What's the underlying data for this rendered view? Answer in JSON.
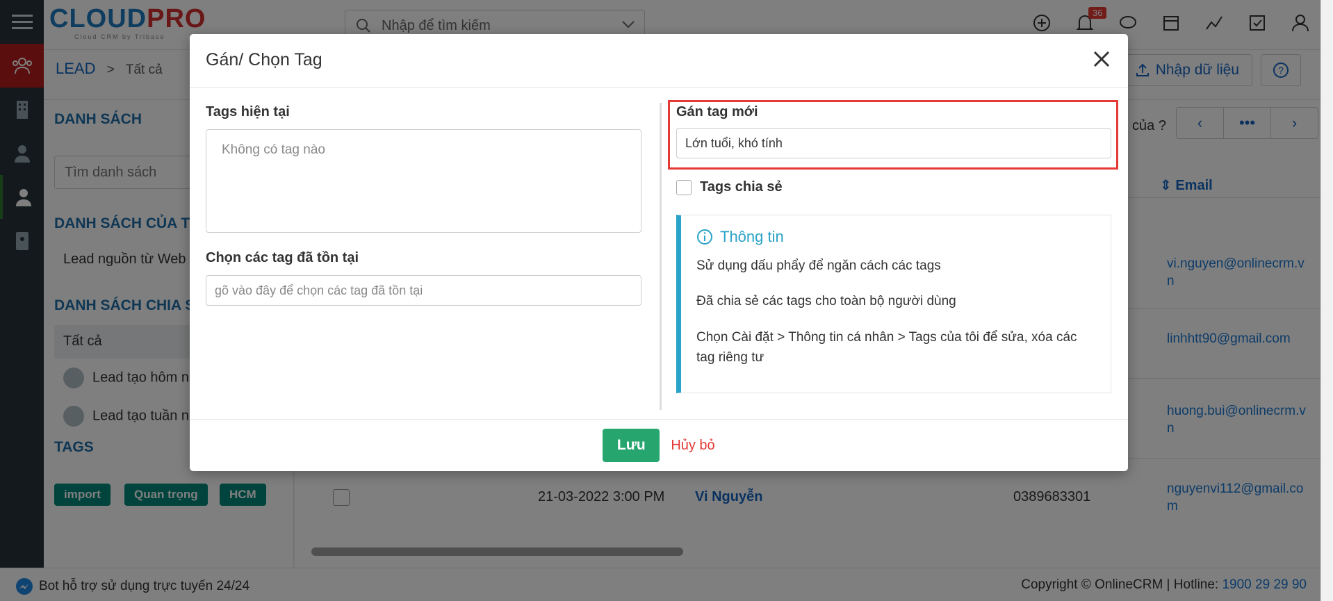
{
  "app": {
    "logo_text_cloud": "CLOUD",
    "logo_text_pro": "PRO",
    "logo_subtitle": "Cloud CRM by Tribase",
    "search_placeholder": "Nhập để tìm kiếm",
    "notification_count": "36"
  },
  "breadcrumb": {
    "module": "LEAD",
    "separator": ">",
    "current": "Tất cả"
  },
  "toolbar": {
    "import_label": "Nhập dữ liệu",
    "of_label": "của",
    "help_label": "?"
  },
  "sidebar": {
    "lists_heading": "DANH SÁCH",
    "search_placeholder": "Tìm danh sách",
    "my_lists_heading": "DANH SÁCH CỦA TÔI",
    "my_lists": [
      "Lead nguồn từ Web"
    ],
    "shared_heading": "DANH SÁCH CHIA SẺ",
    "shared_lists": [
      "Tất cả",
      "Lead tạo hôm nay",
      "Lead tạo tuần này"
    ],
    "tags_heading": "TAGS",
    "tags": [
      "import",
      "Quan trọng",
      "HCM"
    ]
  },
  "table": {
    "email_header": "Email",
    "emails": [
      "vi.nguyen@onlinecrm.vn",
      "linhhtt90@gmail.com",
      "huong.bui@onlinecrm.vn",
      "nguyenvi112@gmail.com"
    ],
    "visible_row": {
      "date": "21-03-2022 3:00 PM",
      "name": "Vi Nguyễn",
      "phone": "0389683301"
    }
  },
  "footer": {
    "bot_text": "Bot hỗ trợ sử dụng trực tuyến 24/24",
    "copyright": "Copyright © OnlineCRM | Hotline:",
    "hotline": "1900 29 29 90"
  },
  "modal": {
    "title": "Gán/ Chọn Tag",
    "current_tags_label": "Tags hiện tại",
    "current_tags_empty": "Không có tag nào",
    "choose_existing_label": "Chọn các tag đã tồn tại",
    "choose_existing_placeholder": "gõ vào đây để chọn các tag đã tồn tại",
    "new_tag_label": "Gán tag mới",
    "new_tag_value": "Lớn tuổi, khó tính",
    "share_tags_label": "Tags chia sẻ",
    "info_title": "Thông tin",
    "info_lines": [
      "Sử dụng dấu phẩy để ngăn cách các tags",
      "Đã chia sẻ các tags cho toàn bộ người dùng",
      "Chọn Cài đặt > Thông tin cá nhân > Tags của tôi để sửa, xóa các tag riêng tư"
    ],
    "save_label": "Lưu",
    "cancel_label": "Hủy bỏ"
  },
  "colors": {
    "primary": "#1565c0",
    "save": "#26a56f",
    "cancel": "#e53935",
    "info_accent": "#29a3c7",
    "highlight": "#e53935",
    "tag_bg": "#00897b"
  }
}
